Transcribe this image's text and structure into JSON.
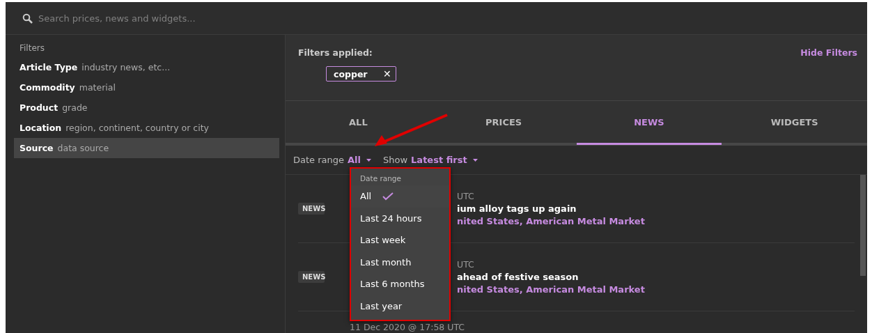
{
  "search": {
    "placeholder": "Search prices, news and widgets..."
  },
  "filters": {
    "title": "Filters",
    "items": [
      {
        "label": "Article Type",
        "hint": "industry news, etc...",
        "selected": false
      },
      {
        "label": "Commodity",
        "hint": "material",
        "selected": false
      },
      {
        "label": "Product",
        "hint": "grade",
        "selected": false
      },
      {
        "label": "Location",
        "hint": "region, continent, country or city",
        "selected": false
      },
      {
        "label": "Source",
        "hint": "data source",
        "selected": true
      }
    ]
  },
  "applied": {
    "title": "Filters applied:",
    "hide_link": "Hide Filters",
    "chips": [
      {
        "label": "copper",
        "remove": "✕"
      }
    ]
  },
  "tabs": [
    {
      "label": "ALL",
      "selected": false
    },
    {
      "label": "PRICES",
      "selected": false
    },
    {
      "label": "NEWS",
      "selected": true
    },
    {
      "label": "WIDGETS",
      "selected": false
    }
  ],
  "toolbar": {
    "date_label": "Date range",
    "date_value": "All",
    "show_label": "Show",
    "show_value": "Latest first"
  },
  "dropdown": {
    "title": "Date range",
    "options": [
      {
        "label": "All",
        "selected": true
      },
      {
        "label": "Last 24 hours",
        "selected": false
      },
      {
        "label": "Last week",
        "selected": false
      },
      {
        "label": "Last month",
        "selected": false
      },
      {
        "label": "Last 6 months",
        "selected": false
      },
      {
        "label": "Last year",
        "selected": false
      }
    ]
  },
  "articles": [
    {
      "tag": "NEWS",
      "date": "UTC",
      "title": "ium alloy tags up again",
      "source": "nited States, American Metal Market",
      "partly_hidden": true
    },
    {
      "tag": "NEWS",
      "date": "UTC",
      "title": "ahead of festive season",
      "source": "nited States, American Metal Market",
      "partly_hidden": true
    },
    {
      "date": "11 Dec 2020 @ 17:58 UTC",
      "partly_hidden": false
    }
  ]
}
